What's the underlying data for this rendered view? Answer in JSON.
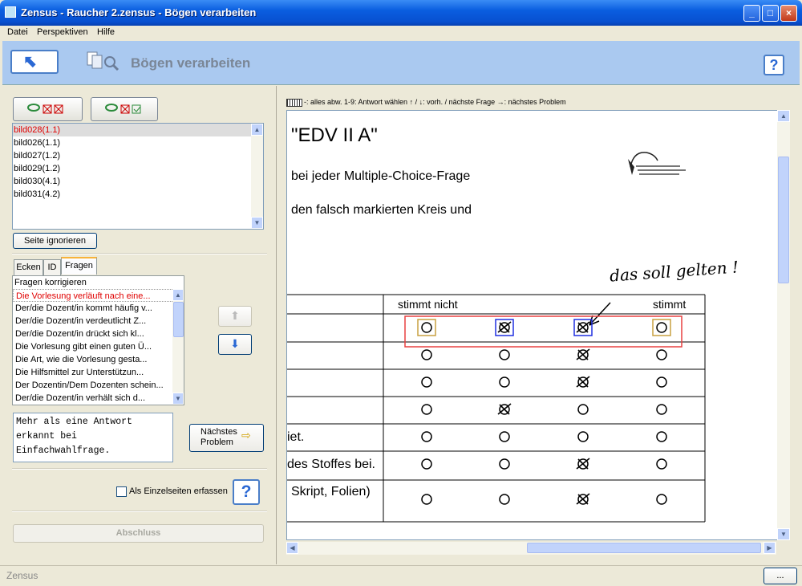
{
  "window": {
    "title": "Zensus - Raucher 2.zensus - Bögen verarbeiten"
  },
  "menu": {
    "items": [
      "Datei",
      "Perspektiven",
      "Hilfe"
    ]
  },
  "header": {
    "title": "Bögen verarbeiten",
    "help": "?"
  },
  "images": {
    "items": [
      {
        "label": "bild028(1.1)",
        "selected": true
      },
      {
        "label": "bild026(1.1)"
      },
      {
        "label": "bild027(1.2)"
      },
      {
        "label": "bild029(1.2)"
      },
      {
        "label": "bild030(4.1)"
      },
      {
        "label": "bild031(4.2)"
      }
    ]
  },
  "ignore_button": "Seite ignorieren",
  "tabs": [
    "Ecken",
    "ID",
    "Fragen"
  ],
  "questions": {
    "header": "Fragen korrigieren",
    "items": [
      "Die Vorlesung verläuft nach eine...",
      "Der/die Dozent/in kommt häufig v...",
      "Der/die Dozent/in verdeutlicht Z...",
      "Der/die Dozent/in drückt sich kl...",
      "Die Vorlesung gibt einen guten Ü...",
      "Die Art, wie die Vorlesung gesta...",
      "Die Hilfsmittel zur Unterstützun...",
      "Der Dozentin/Dem Dozenten schein...",
      "Der/die Dozent/in verhält sich d..."
    ]
  },
  "message": "Mehr als eine Antwort\nerkannt bei\nEinfachwahlfrage.",
  "next_problem": {
    "line1": "Nächstes",
    "line2": "Problem",
    "arrow": "⇨"
  },
  "single_pages": {
    "label": "Als Einzelseiten erfassen",
    "checked": false
  },
  "finish": "Abschluss",
  "hint": "-: alles abw. 1-9: Antwort wählen ↑ / ↓: vorh. / nächste Frage →: nächstes Problem",
  "document": {
    "title": "\"EDV II A\"",
    "line1": "bei jeder Multiple-Choice-Frage",
    "line2": "den falsch markierten Kreis und",
    "handwriting": "das soll gelten !",
    "col_left": "stimmt nicht",
    "col_right": "stimmt",
    "row_texts": [
      "",
      "",
      "",
      "",
      "iet.",
      "des Stoffes bei.",
      "Skript, Folien)"
    ]
  },
  "status": {
    "text": "Zensus",
    "button": "..."
  },
  "colors": {
    "accent": "#0a5ee0",
    "header_bg": "#aac9f0",
    "selected_text": "#e00000",
    "highlight": "#e84040"
  }
}
